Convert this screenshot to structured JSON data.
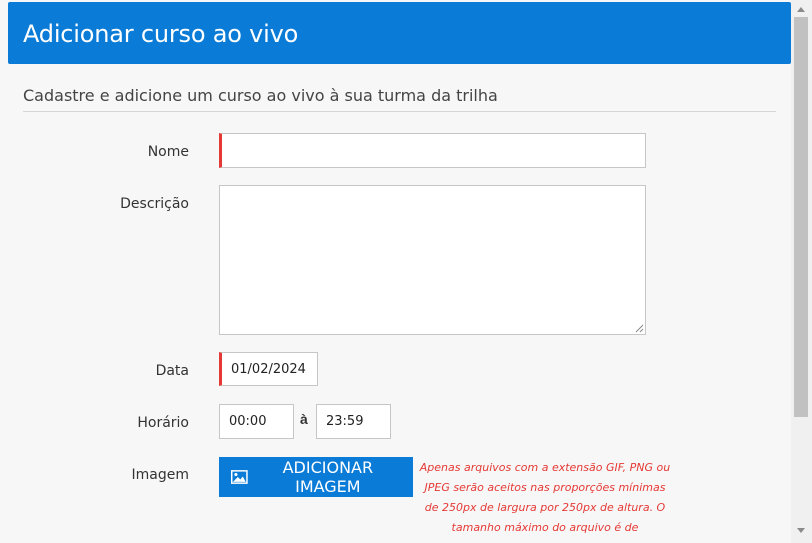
{
  "modal": {
    "title": "Adicionar curso ao vivo",
    "subtitle": "Cadastre e adicione um curso ao vivo à sua turma da trilha"
  },
  "form": {
    "nome": {
      "label": "Nome",
      "value": ""
    },
    "descricao": {
      "label": "Descrição",
      "value": ""
    },
    "data": {
      "label": "Data",
      "value": "01/02/2024"
    },
    "horario": {
      "label": "Horário",
      "start": "00:00",
      "separator": "à",
      "end": "23:59"
    },
    "imagem": {
      "label": "Imagem",
      "button_label": "ADICIONAR IMAGEM",
      "icon": "image-icon",
      "hint": "Apenas arquivos com a extensão GIF, PNG ou JPEG serão aceitos nas proporções mínimas de 250px de largura por 250px de altura. O tamanho máximo do arquivo é de"
    }
  },
  "colors": {
    "accent": "#0a7bd6",
    "required": "#e53935",
    "hint": "#e53935",
    "background": "#f7f7f7"
  }
}
